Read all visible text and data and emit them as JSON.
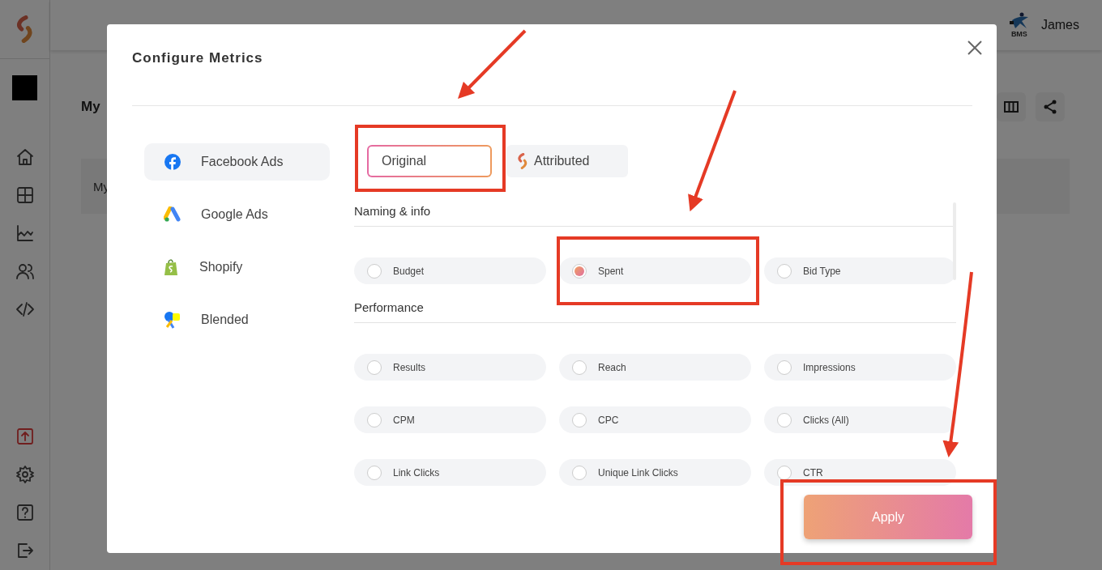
{
  "header": {
    "company_logo_text": "BMS",
    "user": "James"
  },
  "page": {
    "title": "My",
    "card_title": "My"
  },
  "modal": {
    "title": "Configure Metrics",
    "sources": [
      {
        "kind": "facebook",
        "label": "Facebook Ads",
        "selected": true
      },
      {
        "kind": "google",
        "label": "Google Ads",
        "selected": false
      },
      {
        "kind": "shopify",
        "label": "Shopify",
        "selected": false
      },
      {
        "kind": "blended",
        "label": "Blended",
        "selected": false
      }
    ],
    "modes": [
      {
        "kind": "plain",
        "label": "Original",
        "selected": true
      },
      {
        "kind": "attributed",
        "label": "Attributed",
        "selected": false
      }
    ],
    "sections": [
      {
        "title": "Naming & info",
        "metrics": [
          {
            "label": "Budget",
            "selected": false
          },
          {
            "label": "Spent",
            "selected": true
          },
          {
            "label": "Bid Type",
            "selected": false
          }
        ]
      },
      {
        "title": "Performance",
        "metrics": [
          {
            "label": "Results",
            "selected": false
          },
          {
            "label": "Reach",
            "selected": false
          },
          {
            "label": "Impressions",
            "selected": false
          },
          {
            "label": "CPM",
            "selected": false
          },
          {
            "label": "CPC",
            "selected": false
          },
          {
            "label": "Clicks (All)",
            "selected": false
          },
          {
            "label": "Link Clicks",
            "selected": false
          },
          {
            "label": "Unique Link Clicks",
            "selected": false
          },
          {
            "label": "CTR",
            "selected": false
          }
        ]
      }
    ],
    "apply_label": "Apply"
  }
}
